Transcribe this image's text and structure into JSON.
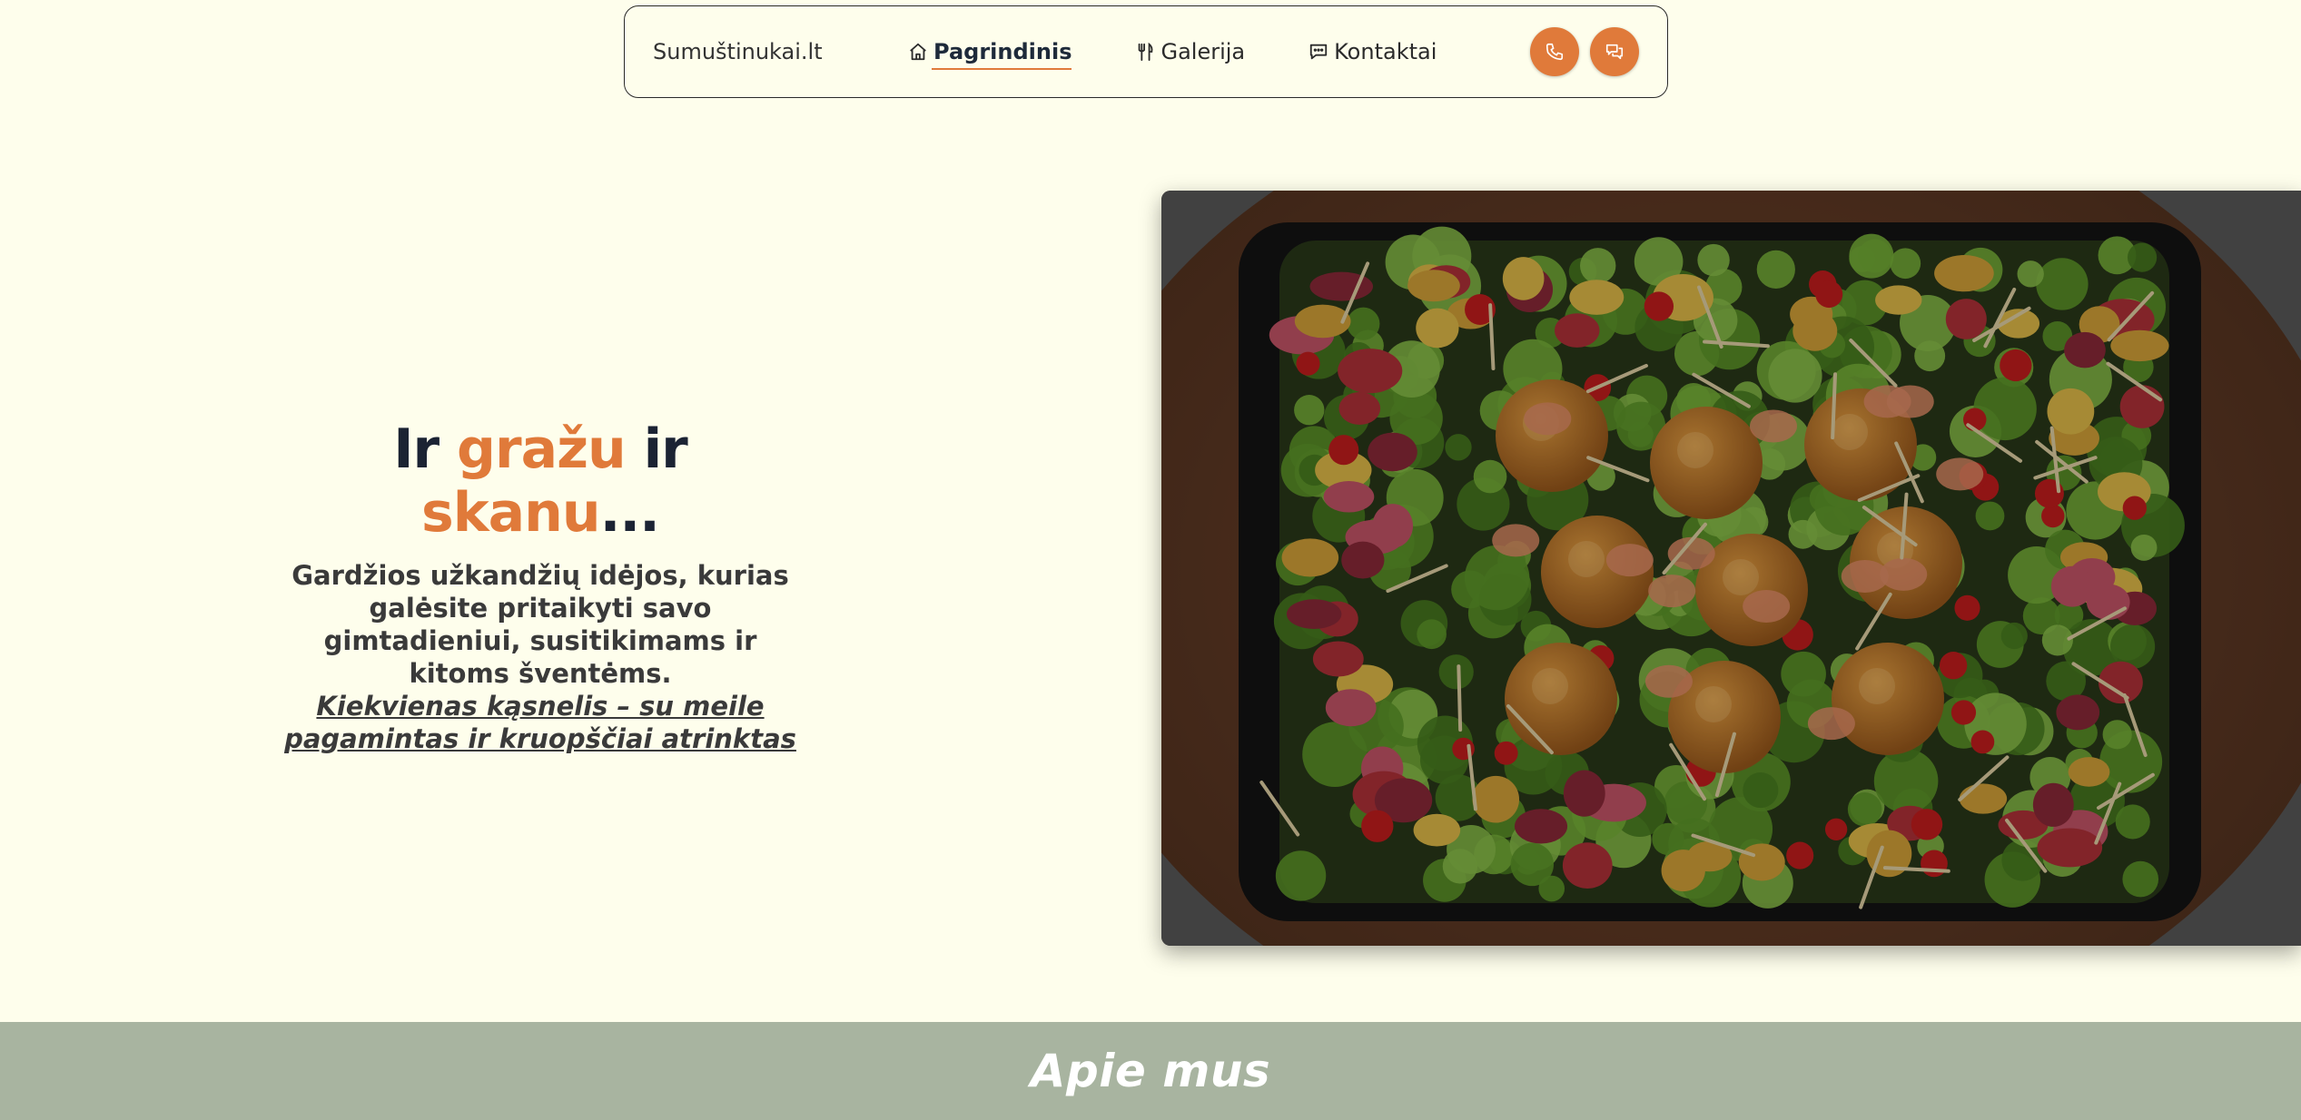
{
  "nav": {
    "brand": "Sumuštinukai.lt",
    "links": [
      {
        "label": "Pagrindinis",
        "icon": "home-icon",
        "active": true
      },
      {
        "label": "Galerija",
        "icon": "fork-knife-icon",
        "active": false
      },
      {
        "label": "Kontaktai",
        "icon": "chat-bubble-icon",
        "active": false
      }
    ],
    "actions": [
      {
        "icon": "phone-icon"
      },
      {
        "icon": "message-icon"
      }
    ]
  },
  "hero": {
    "title_parts": [
      "Ir ",
      "gražu",
      " ir ",
      "skanu",
      "..."
    ],
    "description": "Gardžios užkandžių idėjos, kurias galėsite pritaikyti savo gimtadieniui, susitikimams ir kitoms šventėms.",
    "tagline": "Kiekvienas kąsnelis – su meile pagamintas ir kruopščiai atrinktas",
    "image_alt": "catering-platter-image"
  },
  "about": {
    "title": "Apie mus"
  },
  "colors": {
    "accent": "#e07a3a",
    "background": "#fefeec",
    "band": "#a8b4a0",
    "title_dark": "#1b2333"
  }
}
